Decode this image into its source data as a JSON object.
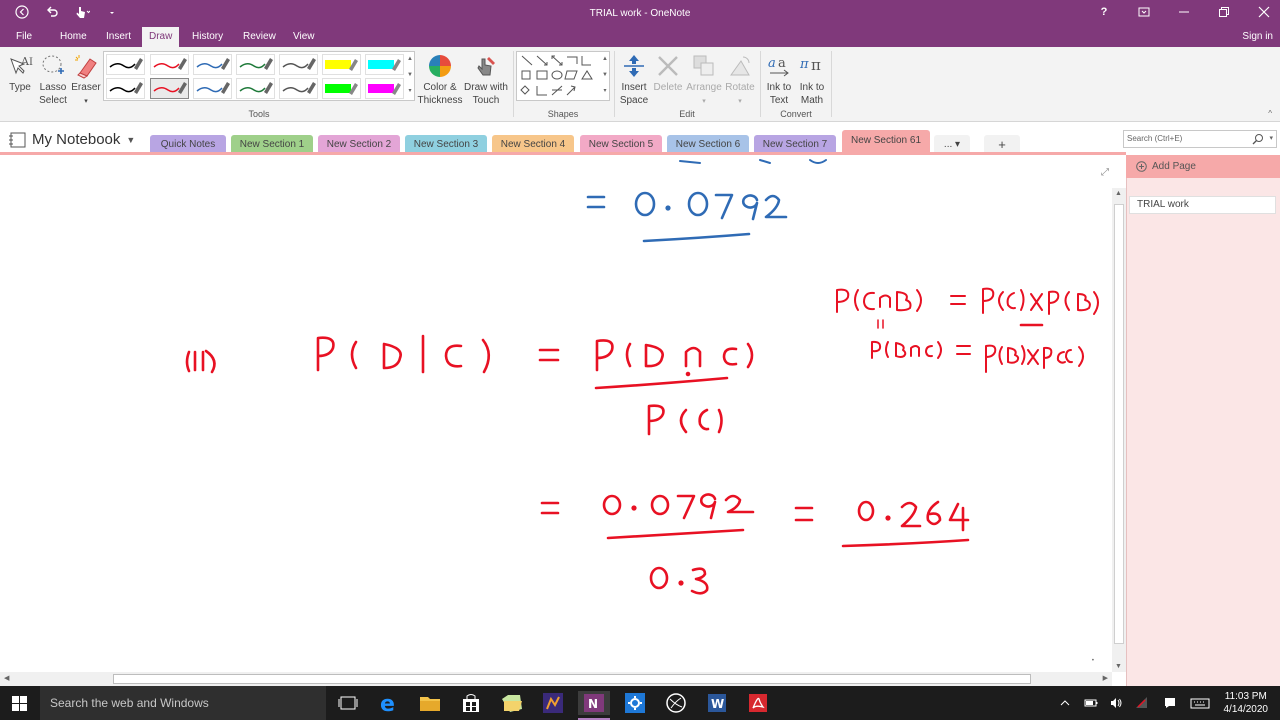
{
  "window": {
    "title": "TRIAL work - OneNote"
  },
  "menu": {
    "items": [
      "File",
      "Home",
      "Insert",
      "Draw",
      "History",
      "Review",
      "View"
    ],
    "active": "Draw",
    "signin": "Sign in"
  },
  "ribbon": {
    "type": "Type",
    "lasso": [
      "Lasso",
      "Select"
    ],
    "eraser": "Eraser",
    "tools_label": "Tools",
    "color_thickness": [
      "Color &",
      "Thickness"
    ],
    "draw_with_touch": [
      "Draw with",
      "Touch"
    ],
    "shapes_label": "Shapes",
    "insert_space": [
      "Insert",
      "Space"
    ],
    "delete": "Delete",
    "arrange": "Arrange",
    "rotate": "Rotate",
    "edit_label": "Edit",
    "ink_to_text": [
      "Ink to",
      "Text"
    ],
    "ink_to_math": [
      "Ink to",
      "Math"
    ],
    "convert_label": "Convert",
    "pen_colors": [
      "#000000",
      "#e81123",
      "#2f6bb5",
      "#1f7a3a",
      "#555555",
      "#ffff00",
      "#00ffff",
      "#000000",
      "#e81123",
      "#2f6bb5",
      "#1f7a3a",
      "#555555",
      "#00ff00",
      "#ff00ff"
    ]
  },
  "notebook": {
    "name": "My Notebook"
  },
  "sections": [
    {
      "label": "Quick Notes",
      "color": "#b8a5e3"
    },
    {
      "label": "New Section 1",
      "color": "#9fd08a"
    },
    {
      "label": "New Section 2",
      "color": "#e3a5d6"
    },
    {
      "label": "New Section 3",
      "color": "#8fd0e0"
    },
    {
      "label": "New Section 4",
      "color": "#f7c68a"
    },
    {
      "label": "New Section 5",
      "color": "#f2a9c6"
    },
    {
      "label": "New Section 6",
      "color": "#a8c3e8"
    },
    {
      "label": "New Section 7",
      "color": "#b8a5e3"
    },
    {
      "label": "New Section 61",
      "color": "#f6a9a9"
    }
  ],
  "more_tabs": "...",
  "add_tab": "+",
  "search": {
    "placeholder": "Search (Ctrl+E)"
  },
  "pages": {
    "add_page": "Add Page",
    "items": [
      "TRIAL work"
    ]
  },
  "taskbar": {
    "search_placeholder": "Search the web and Windows",
    "time": "11:03 PM",
    "date": "4/14/2020"
  }
}
